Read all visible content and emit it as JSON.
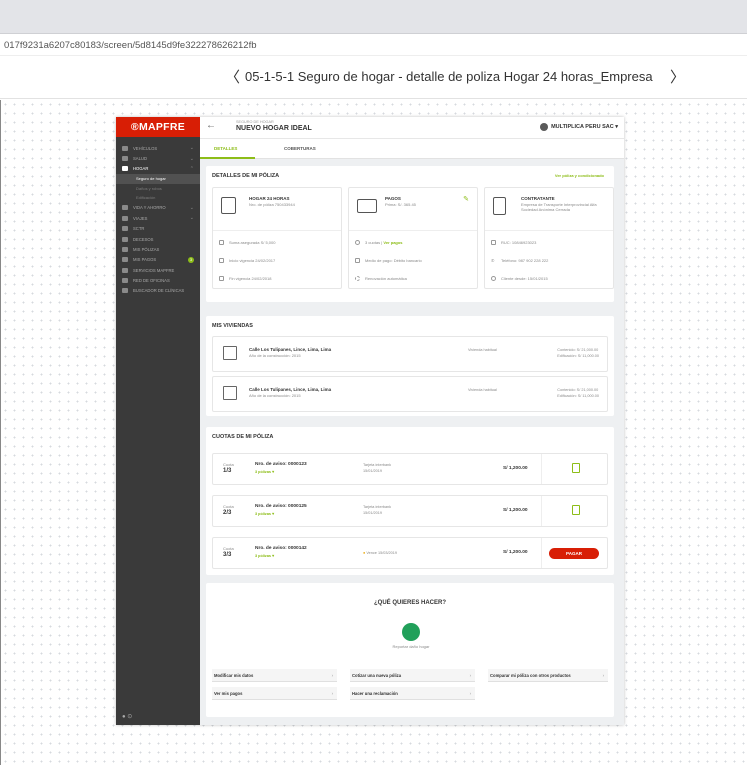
{
  "browser": {
    "url": "017f9231a6207c80183/screen/5d8145d9fe322278626212fb",
    "title": "05-1-5-1 Seguro de hogar - detalle de poliza Hogar 24 horas_Empresa",
    "prev_label": "〈",
    "next_label": "〉"
  },
  "sidebar": {
    "logo": "®MAPFRE",
    "items": [
      {
        "label": "VEHÍCULOS",
        "icon": "car-icon"
      },
      {
        "label": "SALUD",
        "icon": "health-icon"
      },
      {
        "label": "HOGAR",
        "icon": "home-icon"
      },
      {
        "label": "VIDA Y AHORRO",
        "icon": "heart-icon"
      },
      {
        "label": "VIAJES",
        "icon": "plane-icon"
      },
      {
        "label": "SCTR",
        "icon": "worker-icon"
      },
      {
        "label": "DECESOS",
        "icon": "flower-icon"
      },
      {
        "label": "MIS PÓLIZAS",
        "icon": "policy-icon"
      },
      {
        "label": "MIS PAGOS",
        "icon": "card-icon"
      },
      {
        "label": "SERVICIOS MAPFRE",
        "icon": "service-icon"
      },
      {
        "label": "RED DE OFICINAS",
        "icon": "pin-icon"
      },
      {
        "label": "BUSCADOR DE CLÍNICAS",
        "icon": "clinic-icon"
      }
    ],
    "hogar_sub": [
      "Seguro de hogar",
      "Daños y robos",
      "Edificación"
    ],
    "pagos_badge": "3"
  },
  "header": {
    "small": "SEGURO DE HOGAR",
    "title": "NUEVO HOGAR IDEAL",
    "company": "MULTIPLICA PERU SAC ▾"
  },
  "tabs": {
    "detalles": "DETALLES",
    "coberturas": "COBERTURAS"
  },
  "detalles": {
    "title": "DETALLES DE MI PÓLIZA",
    "link": "Ver póliza y condicionado",
    "hogar": {
      "title": "HOGAR 24 HORAS",
      "sub": "Nro. de póliza 750433944",
      "rows": [
        "Suma asegurada S/ 5,000",
        "Inicio vigencia 24/02/2017",
        "Fin vigencia 24/02/2018"
      ]
    },
    "pagos": {
      "title": "PAGOS",
      "sub": "Prima: S/. 365.45",
      "cuotas": "3 cuotas |",
      "ver_pagos": "Ver pagos",
      "rows": [
        "Medio de pago: Débito bancario",
        "Renovación automática"
      ]
    },
    "contratante": {
      "title": "CONTRATANTE",
      "sub": "Empresa de Transporte Interprovincial Alfa Sociedad Anónima Cerrada",
      "rows": [
        "RUC: 10846923023",
        "Teléfono: 987 902 228 222",
        "Cliente desde: 15/01/2015"
      ]
    }
  },
  "viviendas": {
    "title": "MIS VIVIENDAS",
    "items": [
      {
        "address": "Calle Los Tulipanes, Lince, Lima, Lima",
        "year": "Año de la construcción: 2015",
        "type": "Vivienda habitual",
        "contenido": "Contenido: S/ 21,000.00",
        "edificacion": "Edificación: S/ 11,000.00"
      },
      {
        "address": "Calle Los Tulipanes, Lince, Lima, Lima",
        "year": "Año de la construcción: 2015",
        "type": "Vivienda habitual",
        "contenido": "Contenido: S/ 21,000.00",
        "edificacion": "Edificación: S/ 11,000.00"
      }
    ]
  },
  "cuotas": {
    "title": "CUOTAS DE MI PÓLIZA",
    "items": [
      {
        "cuota": "Cuota",
        "num": "1/3",
        "aviso": "Nro. de aviso: 0000123",
        "polizas": "3 pólizas ▾",
        "meta1": "Tarjeta interbank",
        "meta2": "15/01/2019",
        "amount": "S/ 1,200.00"
      },
      {
        "cuota": "Cuota",
        "num": "2/3",
        "aviso": "Nro. de aviso: 0000125",
        "polizas": "3 pólizas ▾",
        "meta1": "Tarjeta interbank",
        "meta2": "15/01/2019",
        "amount": "S/ 1,200.00"
      },
      {
        "cuota": "Cuota",
        "num": "3/3",
        "aviso": "Nro. de aviso: 0000142",
        "polizas": "3 pólizas ▾",
        "meta1": "Vence 15/03/2019",
        "meta2": "",
        "amount": "S/ 1,200.00",
        "pay": "PAGAR"
      }
    ]
  },
  "actions": {
    "question": "¿QUÉ QUIERES HACER?",
    "report": "Reportar daño hogar",
    "items": [
      "Modificar mis datos",
      "Cotizar una nueva póliza",
      "Comparar mi póliza con otros productos",
      "Ver mis pagos",
      "Hacer una reclamación"
    ],
    "arrow": "›"
  },
  "footer": {
    "icons": "● ⊙"
  }
}
